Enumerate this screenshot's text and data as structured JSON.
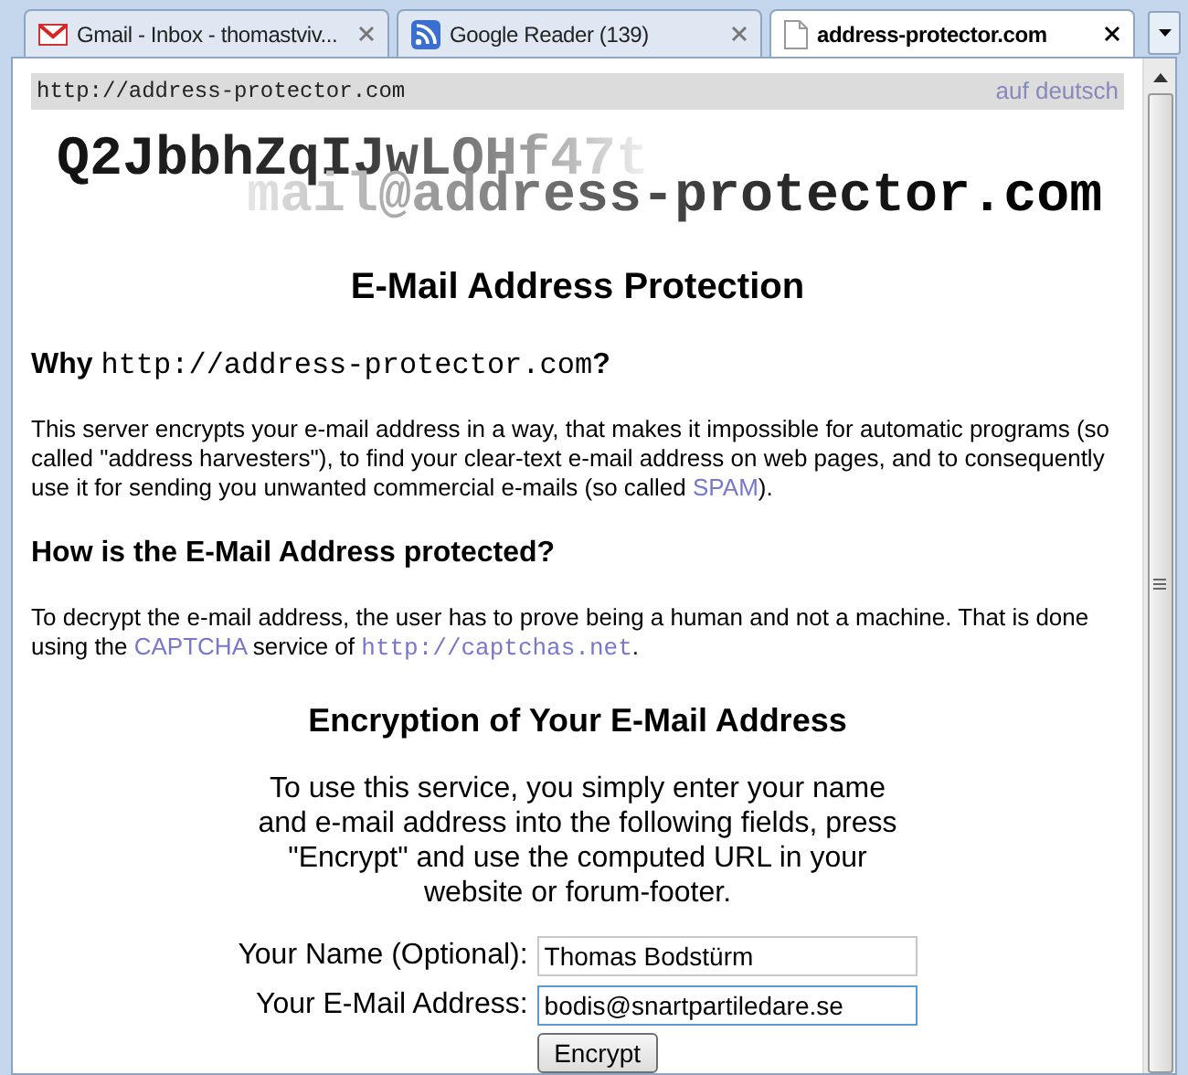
{
  "tabs": [
    {
      "kind": "gmail",
      "title": "Gmail - Inbox - thomastviv...",
      "selected": false
    },
    {
      "kind": "reader",
      "title": "Google Reader (139)",
      "selected": false
    },
    {
      "kind": "page",
      "title": "address-protector.com",
      "selected": true
    }
  ],
  "page": {
    "url_label": "http://address-protector.com",
    "language_link": "auf deutsch",
    "logo": {
      "code": "Q2JbbhZqIJwLOHf47t",
      "email": "mail@address-protector.com"
    },
    "title": "E-Mail Address Protection",
    "sections": [
      {
        "heading": [
          {
            "kind": "plain",
            "text": "Why "
          },
          {
            "kind": "code",
            "text": "http://address-protector.com"
          },
          {
            "kind": "plain",
            "text": "?"
          }
        ],
        "paragraph": [
          {
            "kind": "plain",
            "text": "This server encrypts your e-mail address in a way, that makes it impossible for automatic programs (so called \"address harvesters\"), to find your clear-text e-mail address on web pages, and to consequently use it for sending you unwanted commercial e-mails (so called "
          },
          {
            "kind": "link",
            "text": "SPAM"
          },
          {
            "kind": "plain",
            "text": ")."
          }
        ]
      },
      {
        "heading": [
          {
            "kind": "plain",
            "text": "How is the E-Mail Address protected?"
          }
        ],
        "paragraph": [
          {
            "kind": "plain",
            "text": "To decrypt the e-mail address, the user has to prove being a human and not a machine. That is done using the "
          },
          {
            "kind": "link",
            "text": "CAPTCHA"
          },
          {
            "kind": "plain",
            "text": " service of "
          },
          {
            "kind": "code_link",
            "text": "http://captchas.net"
          },
          {
            "kind": "plain",
            "text": "."
          }
        ]
      }
    ],
    "encryption": {
      "heading": "Encryption of Your E-Mail Address",
      "intro": "To use this service, you simply enter your name and e-mail address into the following fields, press \"Encrypt\" and use the computed URL in your website or forum-footer.",
      "fields": [
        {
          "label": "Your Name (Optional):",
          "value": "Thomas Bodstürm",
          "focused": false
        },
        {
          "label": "Your E-Mail Address:",
          "value": "bodis@snartpartiledare.se",
          "focused": true
        }
      ],
      "button": "Encrypt"
    }
  }
}
